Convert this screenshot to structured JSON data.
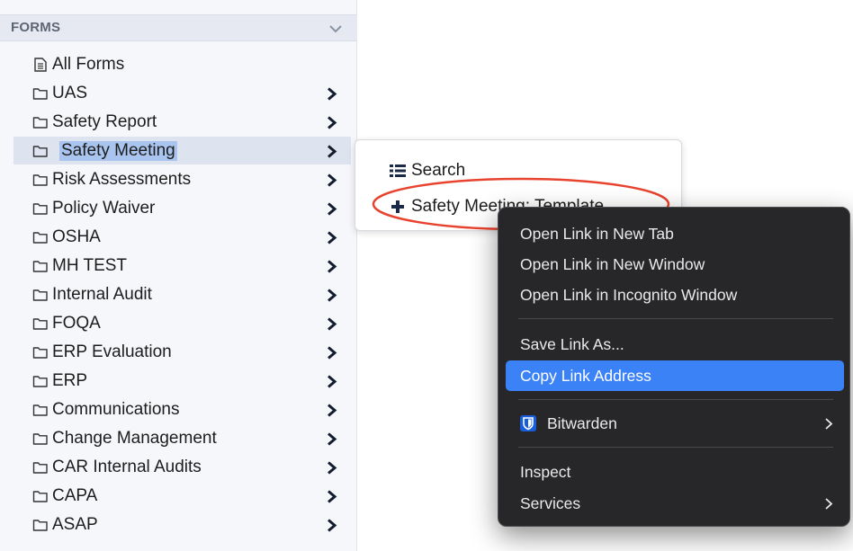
{
  "sidebar": {
    "title": "FORMS",
    "items": [
      {
        "label": "All Forms",
        "icon": "document-icon",
        "has_submenu": false
      },
      {
        "label": "UAS",
        "icon": "folder-icon",
        "has_submenu": true
      },
      {
        "label": "Safety Report",
        "icon": "folder-icon",
        "has_submenu": true
      },
      {
        "label": "Safety Meeting",
        "icon": "folder-icon",
        "has_submenu": true,
        "active": true
      },
      {
        "label": "Risk Assessments",
        "icon": "folder-icon",
        "has_submenu": true
      },
      {
        "label": "Policy Waiver",
        "icon": "folder-icon",
        "has_submenu": true
      },
      {
        "label": "OSHA",
        "icon": "folder-icon",
        "has_submenu": true
      },
      {
        "label": "MH TEST",
        "icon": "folder-icon",
        "has_submenu": true
      },
      {
        "label": "Internal Audit",
        "icon": "folder-icon",
        "has_submenu": true
      },
      {
        "label": "FOQA",
        "icon": "folder-icon",
        "has_submenu": true
      },
      {
        "label": "ERP Evaluation",
        "icon": "folder-icon",
        "has_submenu": true
      },
      {
        "label": "ERP",
        "icon": "folder-icon",
        "has_submenu": true
      },
      {
        "label": "Communications",
        "icon": "folder-icon",
        "has_submenu": true
      },
      {
        "label": "Change Management",
        "icon": "folder-icon",
        "has_submenu": true
      },
      {
        "label": "CAR Internal Audits",
        "icon": "folder-icon",
        "has_submenu": true
      },
      {
        "label": "CAPA",
        "icon": "folder-icon",
        "has_submenu": true
      },
      {
        "label": "ASAP",
        "icon": "folder-icon",
        "has_submenu": true
      }
    ]
  },
  "flyout": {
    "search_label": "Search",
    "template_label": "Safety Meeting: Template"
  },
  "context_menu": {
    "open_new_tab": "Open Link in New Tab",
    "open_new_window": "Open Link in New Window",
    "open_incognito": "Open Link in Incognito Window",
    "save_link_as": "Save Link As...",
    "copy_link_address": "Copy Link Address",
    "bitwarden": "Bitwarden",
    "inspect": "Inspect",
    "services": "Services"
  },
  "colors": {
    "highlight_menu": "#3a82f6",
    "annotation_circle": "#e8432e",
    "sidebar_header": "#e6e9f1",
    "active_row": "#dde3ef",
    "bitwarden_blue": "#175ddc"
  }
}
